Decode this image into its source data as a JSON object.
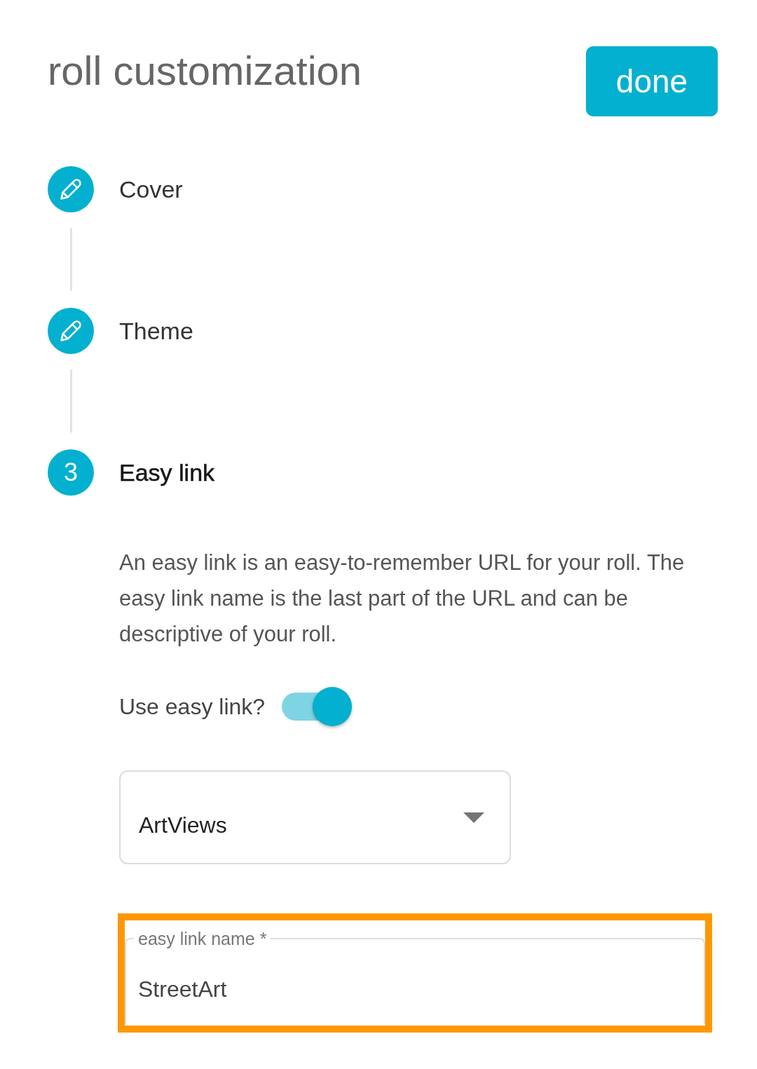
{
  "header": {
    "title": "roll customization",
    "done_button": "done"
  },
  "steps": [
    {
      "kind": "edit",
      "label": "Cover",
      "active": false
    },
    {
      "kind": "edit",
      "label": "Theme",
      "active": false
    },
    {
      "kind": "number",
      "number": "3",
      "label": "Easy link",
      "active": true
    }
  ],
  "easy_link": {
    "description": "An easy link is an easy-to-remember URL for your roll. The easy link name is the last part of the URL and can be descriptive of your roll.",
    "use_easy_link": {
      "label": "Use easy link?",
      "on": true
    },
    "dropdown": {
      "value": "ArtViews"
    },
    "name_field": {
      "label": "easy link name *",
      "value": "StreetArt",
      "highlighted": true
    }
  }
}
